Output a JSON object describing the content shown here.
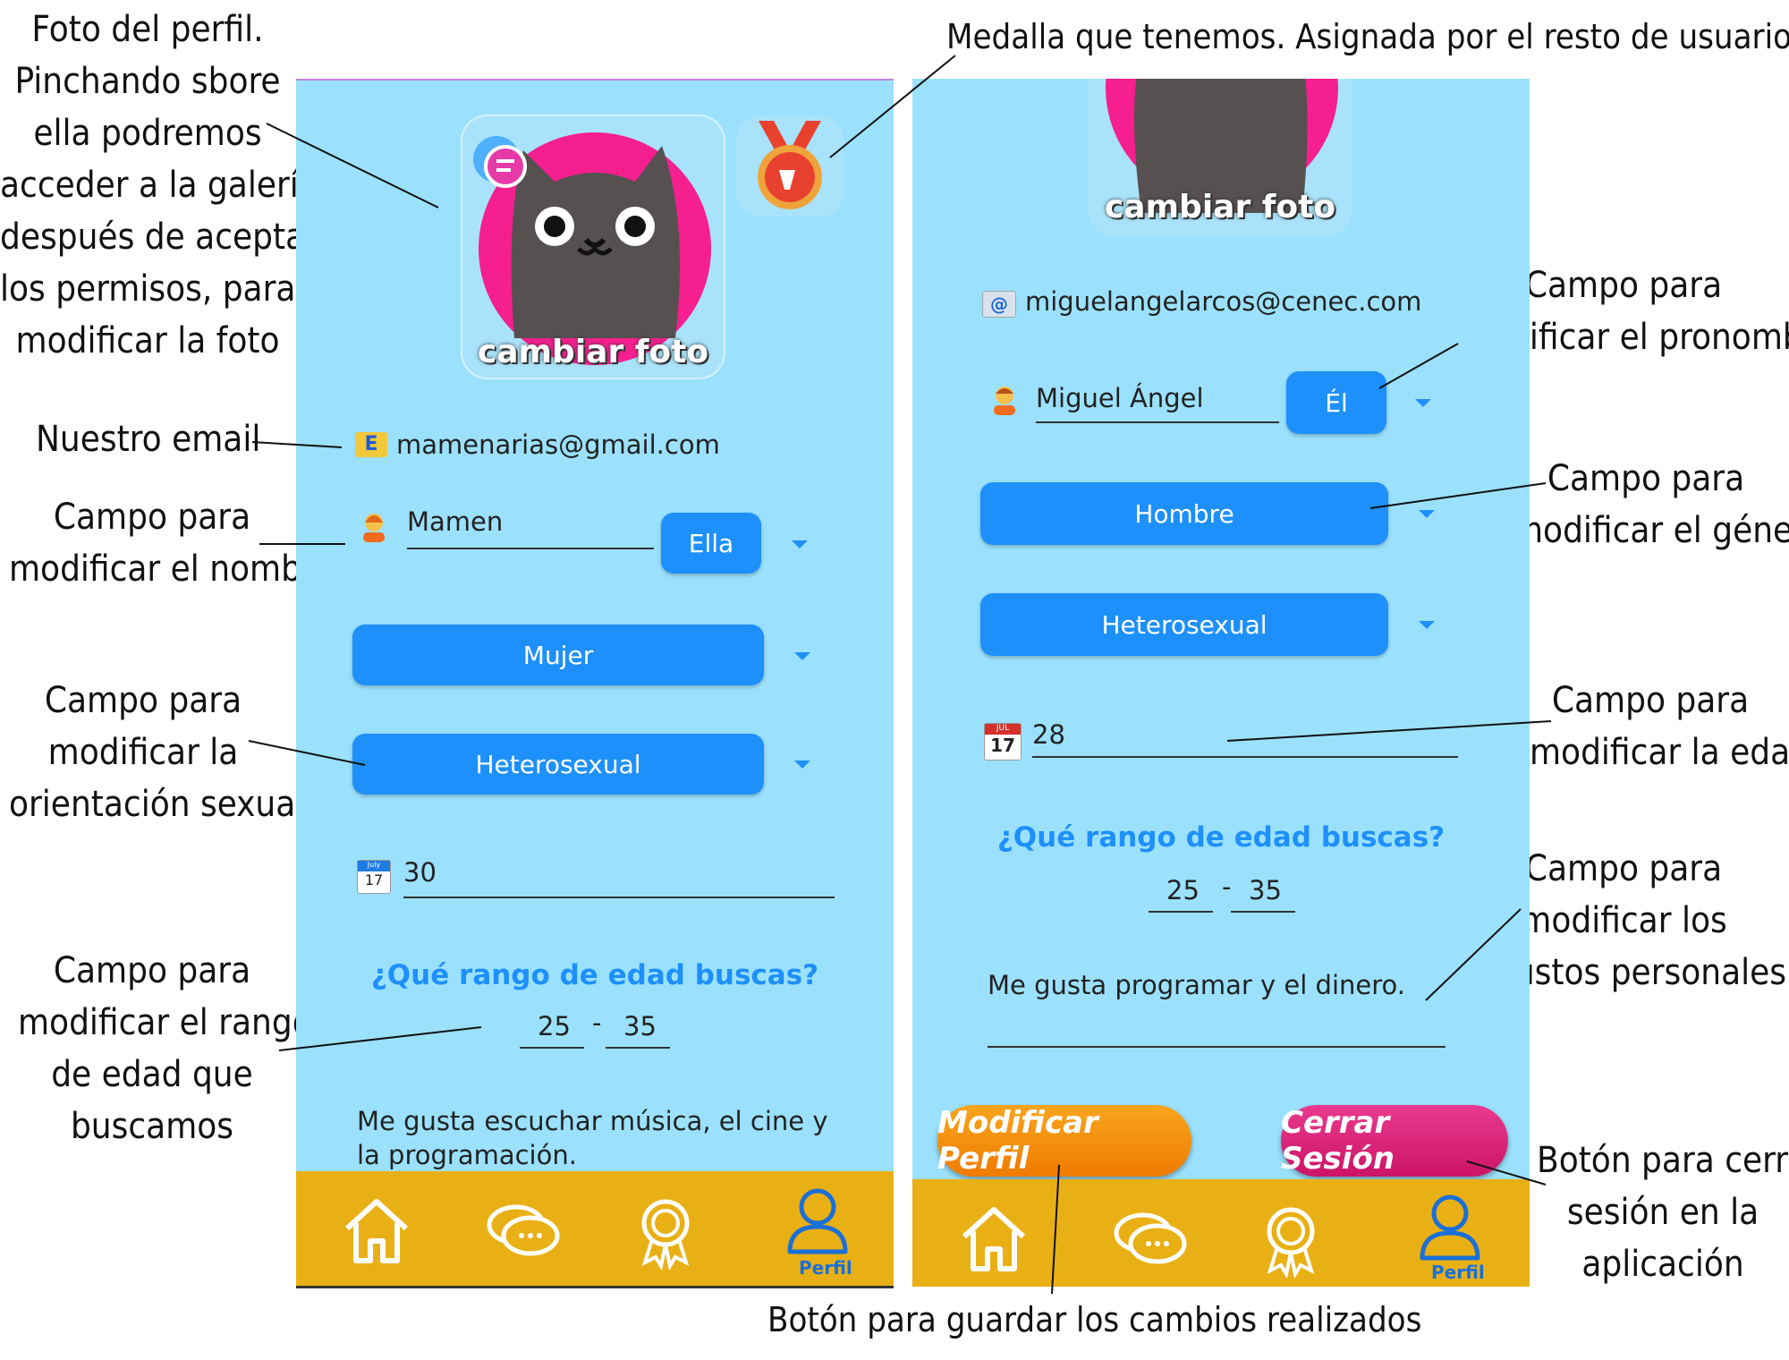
{
  "colors": {
    "sky": "#9be1fd",
    "navbar": "#e9b015",
    "accent": "#1e90fb",
    "orange": "#f08c00",
    "magenta": "#d81b7a"
  },
  "annotations": {
    "profile_photo": [
      "Foto del perfil.",
      "Pinchando sbore",
      "ella podremos",
      "acceder a la galería,",
      "después de aceptar",
      "los permisos, para",
      "modificar la foto"
    ],
    "medal": "Medalla que tenemos. Asignada por el resto de usuarios",
    "email": "Nuestro email",
    "name": [
      "Campo para",
      "modificar el nombre"
    ],
    "orientation": [
      "Campo para",
      "modificar la",
      "orientación sexual"
    ],
    "age_range": [
      "Campo para",
      "modificar el rango",
      "de edad que",
      "buscamos"
    ],
    "pronoun": [
      "Campo para",
      "modificar el pronombre"
    ],
    "gender": [
      "Campo para",
      "modificar el género"
    ],
    "age": [
      "Campo para",
      "modificar la edad"
    ],
    "tastes": [
      "Campo para",
      "modificar los",
      "gustos personales"
    ],
    "logout": [
      "Botón para cerrar",
      "sesión en la",
      "aplicación"
    ],
    "save": "Botón para guardar los cambios realizados"
  },
  "left_screen": {
    "photo_label": "cambiar foto",
    "email": "mamenarias@gmail.com",
    "email_icon": "E",
    "name": "Mamen",
    "pronoun": "Ella",
    "gender": "Mujer",
    "orientation": "Heterosexual",
    "calendar_month": "July",
    "calendar_day": "17",
    "age": "30",
    "question": "¿Qué rango de edad buscas?",
    "range_min": "25",
    "range_sep": "-",
    "range_max": "35",
    "bio_line1": "Me gusta escuchar música, el cine y",
    "bio_line2": "la programación.",
    "nav_label": "Perfil"
  },
  "right_screen": {
    "photo_label": "cambiar foto",
    "email": "miguelangelarcos@cenec.com",
    "email_icon": "@",
    "name": "Miguel Ángel",
    "pronoun": "Él",
    "gender": "Hombre",
    "orientation": "Heterosexual",
    "calendar_month": "JUL",
    "calendar_day": "17",
    "age": "28",
    "question": "¿Qué rango de edad buscas?",
    "range_min": "25",
    "range_sep": "-",
    "range_max": "35",
    "bio": "Me gusta programar y el dinero.",
    "modify_button": "Modificar Perfil",
    "logout_button": "Cerrar Sesión",
    "nav_label": "Perfil"
  }
}
